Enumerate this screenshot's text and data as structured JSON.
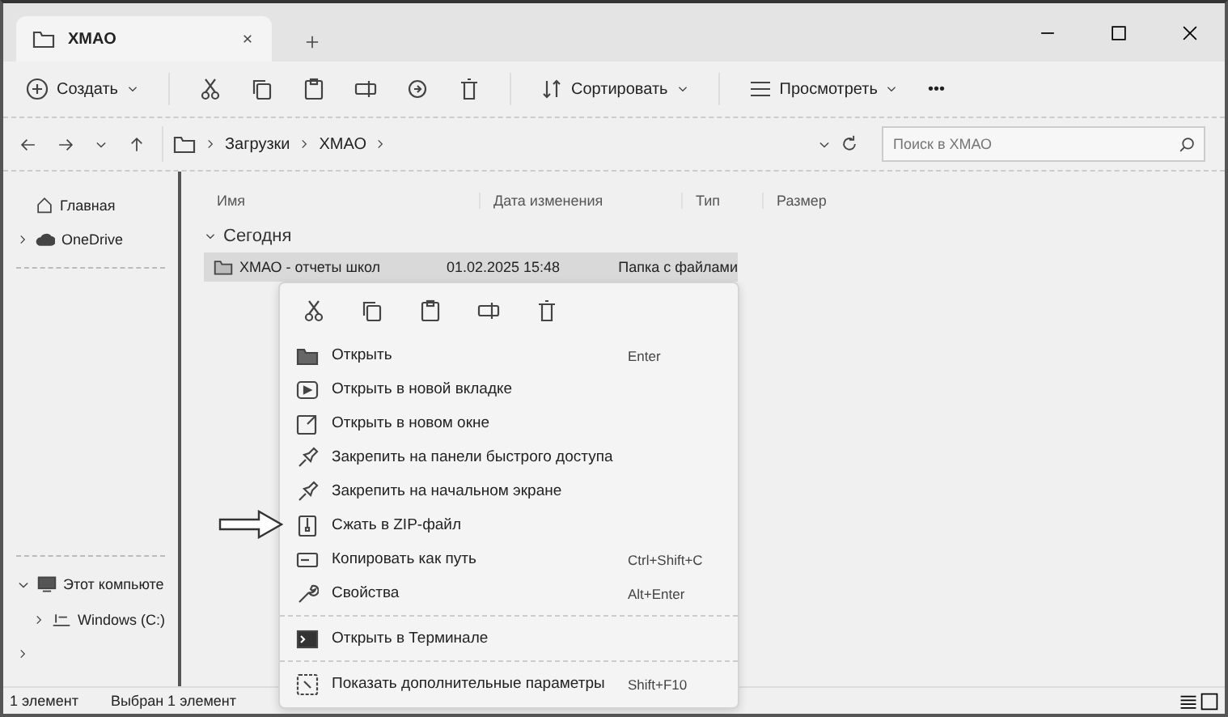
{
  "window": {
    "tab_title": "ХМАО"
  },
  "toolbar": {
    "create": "Создать",
    "sort": "Сортировать",
    "view": "Просмотреть",
    "more": "•••"
  },
  "address": {
    "path": [
      "Загрузки",
      "ХМАО"
    ],
    "search_placeholder": "Поиск в ХМАО"
  },
  "sidebar": {
    "top_items": [
      "Главная",
      "OneDrive"
    ],
    "bottom_items": [
      "Этот компьюте",
      "Windows (C:)"
    ]
  },
  "table": {
    "columns": [
      "Имя",
      "Дата изменения",
      "Тип",
      "Размер"
    ],
    "group": "Сегодня",
    "rows": [
      {
        "name": "ХМАО - отчеты школ",
        "date": "01.02.2025 15:48",
        "type": "Папка с файлами",
        "selected": true
      }
    ]
  },
  "context_menu": {
    "sections": [
      [
        {
          "label": "Открыть",
          "shortcut": "Enter"
        },
        {
          "label": "Открыть в новой вкладке"
        },
        {
          "label": "Открыть в новом окне"
        },
        {
          "label": "Закрепить на панели быстрого доступа"
        },
        {
          "label": "Закрепить на начальном экране"
        },
        {
          "label": "Сжать в ZIP-файл"
        },
        {
          "label": "Копировать как путь",
          "shortcut": "Ctrl+Shift+C"
        },
        {
          "label": "Свойства",
          "shortcut": "Alt+Enter"
        }
      ],
      [
        {
          "label": "Открыть в Терминале"
        }
      ],
      [
        {
          "label": "Показать дополнительные параметры",
          "shortcut": "Shift+F10"
        }
      ]
    ]
  },
  "status_bar": {
    "count": "1 элемент",
    "selection": "Выбран 1 элемент"
  }
}
